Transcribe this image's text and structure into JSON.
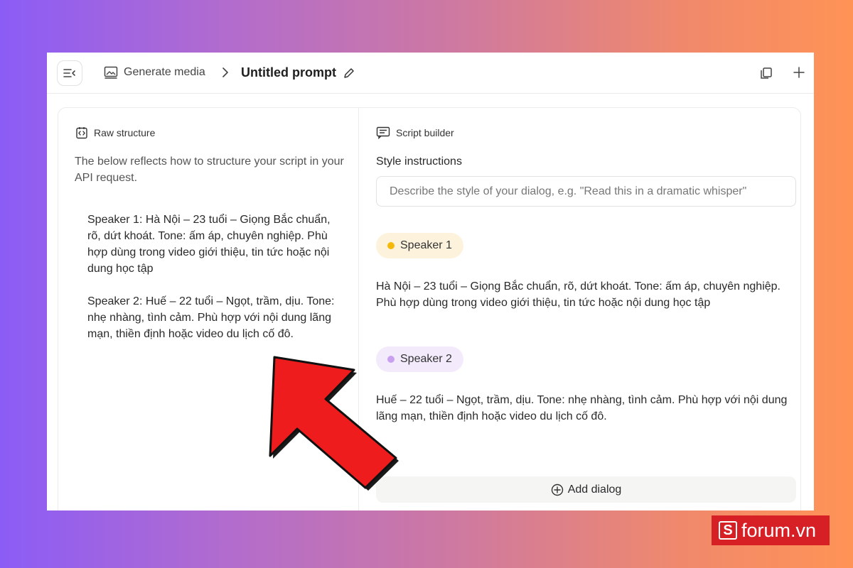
{
  "header": {
    "breadcrumb_media": "Generate media",
    "title": "Untitled prompt"
  },
  "left_panel": {
    "heading": "Raw structure",
    "description": "The below reflects how to structure your script in your API request.",
    "raw_blocks": [
      "Speaker 1: Hà Nội – 23 tuổi – Giọng Bắc chuẩn, rõ, dứt khoát. Tone: ấm áp, chuyên nghiệp. Phù hợp dùng trong video giới thiệu, tin tức hoặc nội dung học tập",
      "Speaker 2: Huế – 22 tuổi – Ngọt, trầm, dịu. Tone: nhẹ nhàng, tình cảm. Phù hợp với nội dung lãng mạn, thiền định hoặc video du lịch cố đô."
    ]
  },
  "right_panel": {
    "heading": "Script builder",
    "style_label": "Style instructions",
    "style_placeholder": "Describe the style of your dialog, e.g. \"Read this in a dramatic whisper\"",
    "speakers": [
      {
        "label": "Speaker 1",
        "dot_color": "#f5b90b",
        "text": "Hà Nội – 23 tuổi – Giọng Bắc chuẩn, rõ, dứt khoát. Tone: ấm áp, chuyên nghiệp. Phù hợp dùng trong video giới thiệu, tin tức hoặc nội dung học tập"
      },
      {
        "label": "Speaker 2",
        "dot_color": "#c9a0f0",
        "text": "Huế – 22 tuổi – Ngọt, trầm, dịu. Tone: nhẹ nhàng, tình cảm. Phù hợp với nội dung lãng mạn, thiền định hoặc video du lịch cố đô."
      }
    ],
    "add_dialog_label": "Add dialog"
  },
  "watermark": {
    "text": "forum.vn",
    "badge_letter": "S"
  },
  "colors": {
    "annotation_arrow": "#ee1c1c"
  }
}
